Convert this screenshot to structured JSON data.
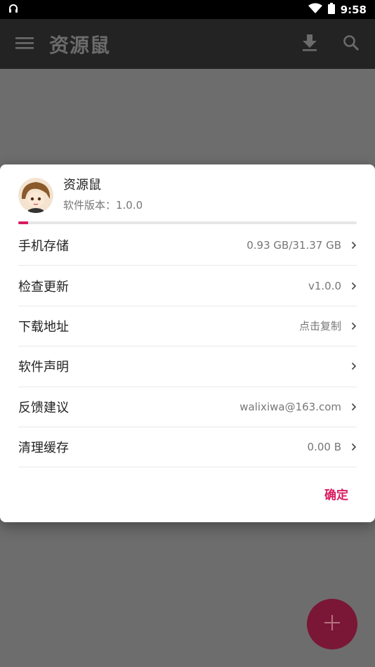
{
  "status_bar": {
    "time": "9:58",
    "wifi_icon": "wifi-icon",
    "battery_icon": "battery-icon",
    "notification_icon": "headset-icon"
  },
  "app_bar": {
    "title": "资源鼠",
    "menu_icon": "hamburger-menu-icon",
    "download_icon": "download-icon",
    "search_icon": "search-icon"
  },
  "dialog": {
    "title": "资源鼠",
    "version_text": "软件版本：1.0.0",
    "storage_progress": 0.0296,
    "rows": [
      {
        "label": "手机存储",
        "value": "0.93 GB/31.37 GB"
      },
      {
        "label": "检查更新",
        "value": "v1.0.0"
      },
      {
        "label": "下载地址",
        "value": "点击复制"
      },
      {
        "label": "软件声明",
        "value": ""
      },
      {
        "label": "反馈建议",
        "value": "walixiwa@163.com"
      },
      {
        "label": "清理缓存",
        "value": "0.00 B"
      }
    ],
    "confirm_label": "确定"
  },
  "fab": {
    "icon": "plus-icon"
  },
  "colors": {
    "accent": "#d81b60",
    "status_bar": "#000000",
    "app_bar": "#232323",
    "scrim": "#6d6d6d"
  }
}
